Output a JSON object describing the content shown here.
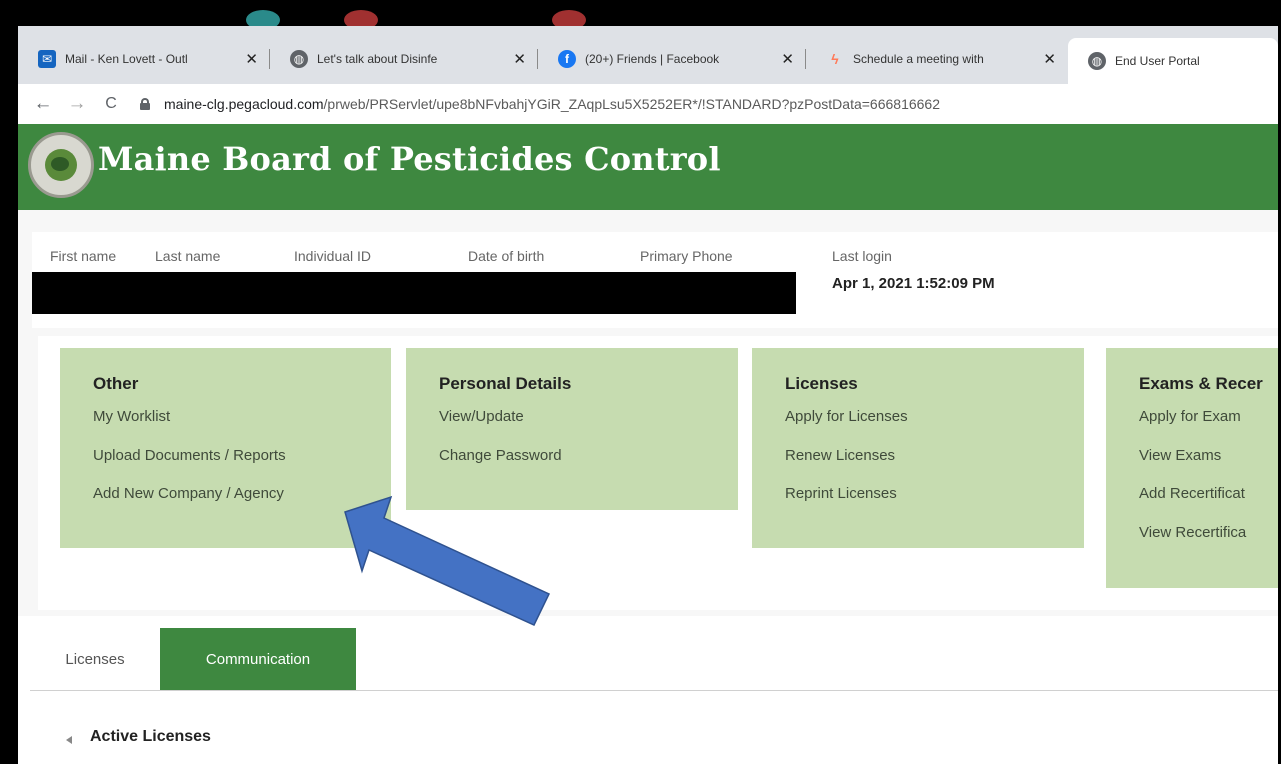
{
  "browser": {
    "tabs": [
      {
        "label": "Mail - Ken Lovett - Outl",
        "icon": "outlook-icon",
        "close": "✕"
      },
      {
        "label": "Let's talk about Disinfe",
        "icon": "globe-icon",
        "close": "✕"
      },
      {
        "label": "(20+) Friends | Facebook",
        "icon": "facebook-icon",
        "close": "✕"
      },
      {
        "label": "Schedule a meeting with",
        "icon": "hubspot-icon",
        "close": "✕"
      },
      {
        "label": "End User Portal",
        "icon": "globe-icon"
      }
    ],
    "url_host": "maine-clg.pegacloud.com",
    "url_path": "/prweb/PRServlet/upe8bNFvbahjYGiR_ZAqpLsu5X5252ER*/!STANDARD?pzPostData=666816662",
    "back_icon": "←",
    "forward_icon": "→",
    "reload_icon": "C"
  },
  "header": {
    "title": "Maine Board of Pesticides Control"
  },
  "user_info": {
    "labels": {
      "first_name": "First name",
      "last_name": "Last name",
      "individual_id": "Individual ID",
      "date_of_birth": "Date of birth",
      "primary_phone": "Primary Phone",
      "last_login": "Last login"
    },
    "last_login_value": "Apr 1, 2021 1:52:09 PM"
  },
  "cards": {
    "other": {
      "title": "Other",
      "links": [
        "My Worklist",
        "Upload Documents / Reports",
        "Add New Company / Agency"
      ]
    },
    "personal": {
      "title": "Personal Details",
      "links": [
        "View/Update",
        "Change Password"
      ]
    },
    "licenses": {
      "title": "Licenses",
      "links": [
        "Apply for Licenses",
        "Renew Licenses",
        "Reprint Licenses"
      ]
    },
    "exams": {
      "title": "Exams & Recer",
      "links": [
        "Apply for Exam",
        "View Exams",
        "Add Recertificat",
        "View Recertifica"
      ]
    }
  },
  "tabs": {
    "licenses": "Licenses",
    "communication": "Communication"
  },
  "section": {
    "title": "Active Licenses"
  },
  "colors": {
    "header_green": "#3e8840",
    "card_green": "#c6dcb0",
    "arrow_blue": "#4472c4"
  }
}
